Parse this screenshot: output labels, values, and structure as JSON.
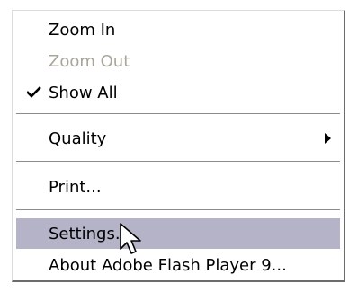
{
  "menu": {
    "items": [
      {
        "label": "Zoom In",
        "enabled": true,
        "checked": false
      },
      {
        "label": "Zoom Out",
        "enabled": false,
        "checked": false
      },
      {
        "label": "Show All",
        "enabled": true,
        "checked": true
      },
      {
        "label": "Quality",
        "enabled": true,
        "submenu": true
      },
      {
        "label": "Print...",
        "enabled": true
      },
      {
        "label": "Settings...",
        "enabled": true,
        "highlighted": true
      },
      {
        "label": "About Adobe Flash Player 9...",
        "enabled": true
      }
    ]
  },
  "colors": {
    "highlight": "#b4b3c7",
    "disabled_text": "#a7a49a",
    "separator": "#8c8c8c"
  },
  "icons": {
    "check": "checkmark-icon",
    "submenu": "submenu-arrow-icon",
    "pointer": "mouse-pointer-icon"
  }
}
